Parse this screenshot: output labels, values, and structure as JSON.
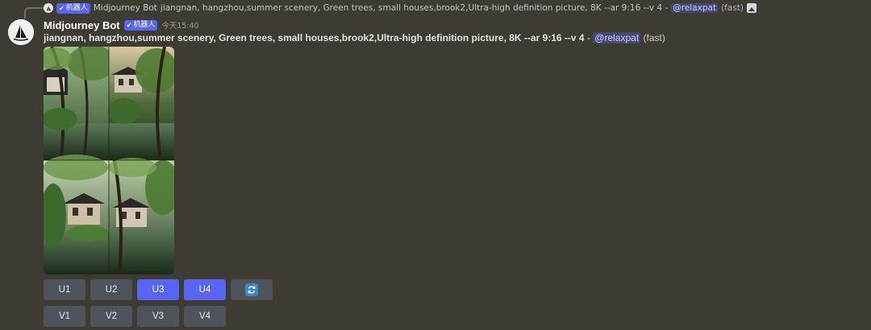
{
  "reply": {
    "bot_name": "Midjourney Bot",
    "bot_tag": "机器人",
    "text": "jiangnan, hangzhou,summer scenery, Green trees, small houses,brook2,Ultra-high definition picture, 8K --ar 9:16 --v 4 -",
    "mention": "@relaxpat",
    "suffix": "(fast)"
  },
  "message": {
    "username": "Midjourney Bot",
    "bot_tag": "机器人",
    "timestamp": "今天15:40",
    "prompt": "jiangnan, hangzhou,summer scenery, Green trees, small houses,brook2,Ultra-high definition picture, 8K --ar 9:16 --v 4",
    "separator": " - ",
    "mention": "@relaxpat",
    "suffix": "(fast)"
  },
  "buttons": {
    "row1": [
      {
        "label": "U1",
        "active": false
      },
      {
        "label": "U2",
        "active": false
      },
      {
        "label": "U3",
        "active": true
      },
      {
        "label": "U4",
        "active": true
      }
    ],
    "row2": [
      {
        "label": "V1",
        "active": false
      },
      {
        "label": "V2",
        "active": false
      },
      {
        "label": "V3",
        "active": false
      },
      {
        "label": "V4",
        "active": false
      }
    ],
    "reroll_icon": "refresh-icon"
  },
  "colors": {
    "background": "#3e3b33",
    "blurple": "#5865f2",
    "button_gray": "#4f545c"
  }
}
